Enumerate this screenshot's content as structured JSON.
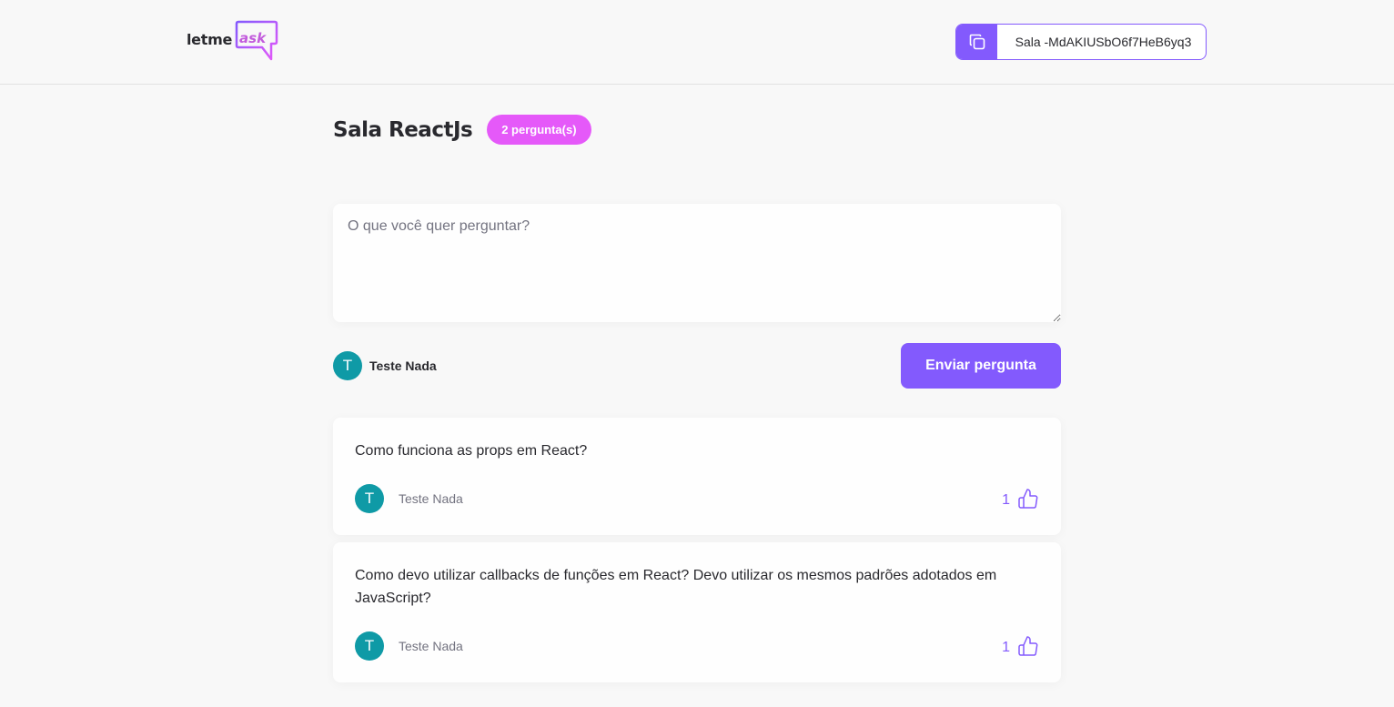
{
  "header": {
    "logo": {
      "prefix": "letme",
      "suffix": "ask"
    },
    "room_code": {
      "text": "Sala -MdAKIUSbO6f7HeB6yq3",
      "icon": "copy-icon"
    }
  },
  "room": {
    "title": "Sala ReactJs",
    "question_count": "2 pergunta(s)"
  },
  "form": {
    "placeholder": "O que você quer perguntar?",
    "value": "",
    "user": {
      "avatar_initial": "T",
      "name": "Teste Nada"
    },
    "submit_label": "Enviar pergunta"
  },
  "questions": [
    {
      "content": "Como funciona as props em React?",
      "author_initial": "T",
      "author": "Teste Nada",
      "likes": "1",
      "like_icon": "thumbs-up-icon"
    },
    {
      "content": "Como devo utilizar callbacks de funções em React? Devo utilizar os mesmos padrões adotados em JavaScript?",
      "author_initial": "T",
      "author": "Teste Nada",
      "likes": "1",
      "like_icon": "thumbs-up-icon"
    }
  ],
  "colors": {
    "accent": "#835afd",
    "badge": "#e559f9",
    "avatar": "#0f9aa6",
    "background": "#f8f8f8"
  }
}
